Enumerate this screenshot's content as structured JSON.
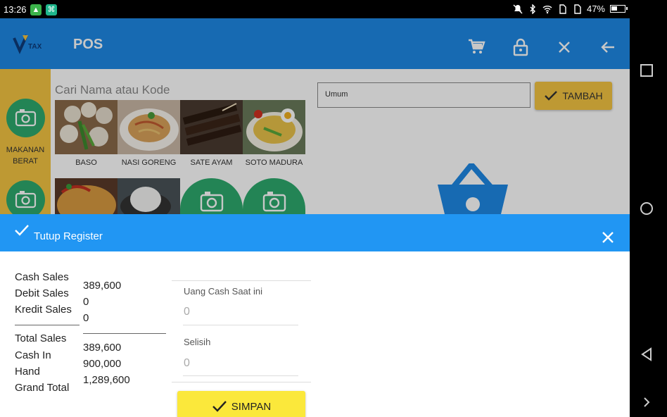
{
  "status_bar": {
    "time": "13:26",
    "battery": "47%",
    "icons": [
      "notifications-off-icon",
      "bluetooth-icon",
      "wifi-icon",
      "sim1-icon",
      "sim2-icon",
      "battery-icon"
    ]
  },
  "app_bar": {
    "logo_text": "TAX",
    "title": "POS",
    "color": "#1e88e5"
  },
  "categories": [
    {
      "label": "MAKANAN\nBERAT"
    },
    {
      "label": ""
    }
  ],
  "search": {
    "placeholder": "Cari Nama atau Kode"
  },
  "products": [
    {
      "name": "BASO"
    },
    {
      "name": "NASI GORENG"
    },
    {
      "name": "SATE AYAM"
    },
    {
      "name": "SOTO MADURA"
    }
  ],
  "customer": {
    "value": "Umum"
  },
  "add_button": {
    "label": "TAMBAH"
  },
  "dialog": {
    "title": "Tutup Register",
    "rows_left": [
      "Cash Sales",
      "Debit Sales",
      "Kredit Sales"
    ],
    "values_left": [
      "389,600",
      "0",
      "0"
    ],
    "rows_bottom": [
      "Total Sales",
      "Cash In",
      "Hand",
      "Grand Total"
    ],
    "values_bottom": [
      "389,600",
      "900,000",
      "1,289,600"
    ],
    "field_cash_label": "Uang Cash Saat ini",
    "field_cash_value": "0",
    "field_diff_label": "Selisih",
    "field_diff_value": "0",
    "save_label": "SIMPAN"
  }
}
